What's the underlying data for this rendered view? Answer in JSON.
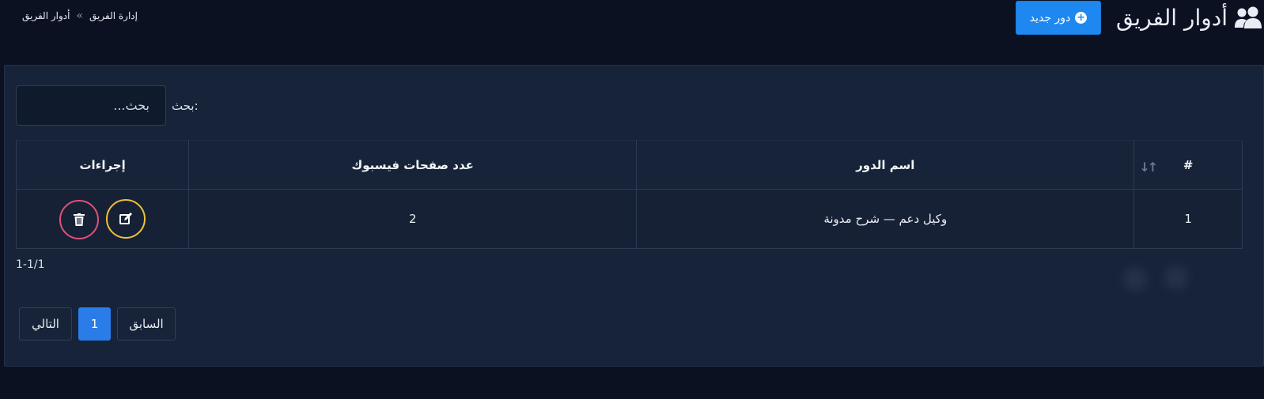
{
  "header": {
    "title": "أدوار الفريق",
    "title_icon": "users-icon",
    "new_button_label": "دور جديد",
    "new_button_icon": "plus-circle-icon",
    "accent_color": "#1e88f0"
  },
  "breadcrumb": {
    "items": [
      "إدارة الفريق",
      "أدوار الفريق"
    ],
    "separator": "»"
  },
  "search": {
    "label": "بحث:",
    "placeholder": "بحث..."
  },
  "table": {
    "columns": [
      "#",
      "اسم الدور",
      "عدد صفحات فيسبوك",
      "إجراءات"
    ],
    "rows": [
      {
        "index": "1",
        "role_name": "وكيل دعم — شرح مدونة",
        "facebook_pages": "2"
      }
    ],
    "actions": [
      "edit-icon",
      "trash-icon"
    ]
  },
  "range_info": "1-1/1",
  "pagination": {
    "next_label": "التالي",
    "current_page": "1",
    "prev_label": "السابق"
  },
  "colors": {
    "background": "#0b1121",
    "card": "#172338",
    "edit_border": "#f0c13a",
    "delete_border": "#e0507a",
    "active_page": "#2a7de8"
  }
}
